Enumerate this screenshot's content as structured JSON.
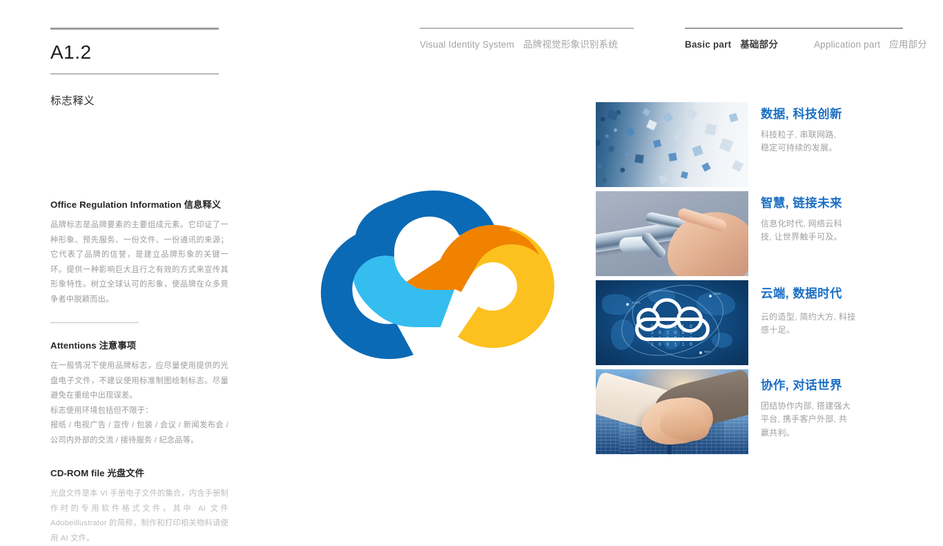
{
  "topnav": {
    "left_group": {
      "english": "Visual Identity System",
      "chinese": "品牌视觉形象识别系统"
    },
    "right_group": {
      "active": {
        "english": "Basic part",
        "chinese": "基础部分"
      },
      "inactive": {
        "english": "Application part",
        "chinese": "应用部分"
      }
    }
  },
  "doc_header": {
    "code": "A1.2",
    "subtitle": "标志释义"
  },
  "blocks": [
    {
      "title": "Office Regulation Information 信息释义",
      "body": "品牌标志是品牌要素的主要组成元素。它印证了一种形象、预先服务、一份文件、一份通讯的来源；它代表了品牌的信誉，是建立品牌形象的关键一环。提供一种影响巨大且行之有效的方式来宣传其形象特性。树立全球认可的形象，使品牌在众多竞争者中脱颖而出。"
    },
    {
      "title": "Attentions 注意事项",
      "body_1": "在一般情况下使用品牌标志，应尽量使用提供的光盘电子文件，不建议使用标准制图绘制标志。尽量避免在重绘中出现误差。",
      "body_2": "标志使用环境包括但不限于：",
      "body_3": "报纸 / 电视广告 / 宣传 / 包装 / 会议 / 新闻发布会 / 公司内外部的交流 / 接待服务 / 纪念品等。"
    },
    {
      "title": "CD-ROM file 光盘文件",
      "body": "光盘文件是本 VI 手册电子文件的集合，内含手册制作时的专用软件格式文件。其中 AI 文件 Adobeillustrator 的简称，制作和打印相关物料请使用 AI 文件。"
    }
  ],
  "logo": {
    "name": "cloud-logo",
    "colors": {
      "dark_blue": "#0b6ab5",
      "light_blue": "#35bdf0",
      "orange": "#f08200",
      "yellow": "#fcc11e"
    }
  },
  "media_items": [
    {
      "image_name": "blue-cubes-particles-photo",
      "title": "数据, 科技创新",
      "desc_line_1": "科技粒子, 串联网路,",
      "desc_line_2": "稳定可持续的发展。"
    },
    {
      "image_name": "robot-hand-human-finger-photo",
      "title": "智慧, 链接未来",
      "desc_line_1": "信息化时代, 网络云科",
      "desc_line_2": "技, 让世界触手可及。"
    },
    {
      "image_name": "cloud-world-map-data-photo",
      "title": "云端, 数据时代",
      "desc_line_1": "云的造型, 简约大方, 科技",
      "desc_line_2": "感十足。"
    },
    {
      "image_name": "handshake-skyscrapers-photo",
      "title": "协作, 对话世界",
      "desc_line_1": "团结协作内部, 搭建强大",
      "desc_line_2": "平台, 携手客户外部, 共",
      "desc_line_3": "赢共利。"
    }
  ],
  "thumb3_overlay": {
    "binary_rows": "0 1 0 1 1 0\n1 0 1 0 0 1\n0 1 1 0 1 0\n1 0 0 1 1 0",
    "node_labels": [
      "NEW",
      "DATA",
      "NET",
      "SYS"
    ]
  }
}
